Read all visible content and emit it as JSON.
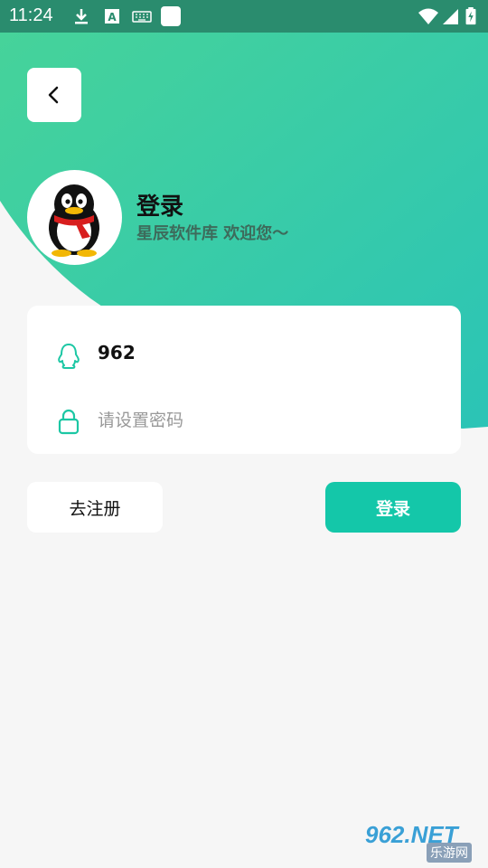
{
  "status_bar": {
    "time": "11:24",
    "icons": [
      "download-icon",
      "a-icon",
      "keyboard-icon",
      "square-icon",
      "wifi-icon",
      "signal-icon",
      "battery-icon"
    ]
  },
  "header": {
    "title": "登录",
    "subtitle": "星辰软件库 欢迎您～",
    "avatar": "qq-penguin-avatar"
  },
  "form": {
    "account_value": "962",
    "password_placeholder": "请设置密码"
  },
  "buttons": {
    "register_label": "去注册",
    "login_label": "登录"
  },
  "watermark": {
    "main": "962.NET",
    "sub": "乐游网"
  },
  "colors": {
    "accent": "#14c7a9",
    "gradient_start": "#46d39a",
    "gradient_end": "#2bc4b6",
    "background": "#f6f6f6"
  }
}
